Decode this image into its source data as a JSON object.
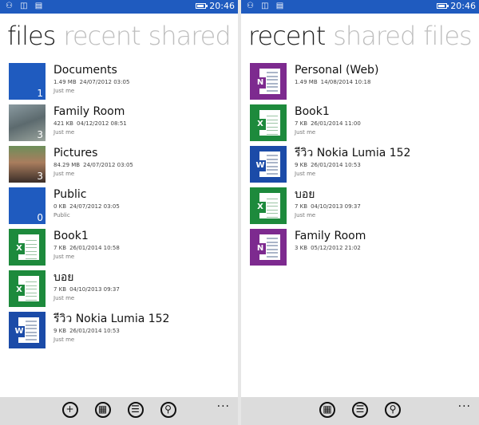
{
  "status": {
    "time": "20:46",
    "icons": "⚇ ◫ ▤"
  },
  "left": {
    "pivot": [
      "files",
      "recent",
      "shared"
    ],
    "items": [
      {
        "type": "folder",
        "name": "Documents",
        "size": "1.49 MB",
        "date": "24/07/2012 03:05",
        "owner": "Just me",
        "count": "1"
      },
      {
        "type": "photo1",
        "name": "Family Room",
        "size": "421 KB",
        "date": "04/12/2012 08:51",
        "owner": "Just me",
        "count": "3"
      },
      {
        "type": "photo2",
        "name": "Pictures",
        "size": "84.29 MB",
        "date": "24/07/2012 03:05",
        "owner": "Just me",
        "count": "3"
      },
      {
        "type": "folder",
        "name": "Public",
        "size": "0 KB",
        "date": "24/07/2012 03:05",
        "owner": "Public",
        "count": "0"
      },
      {
        "type": "excel",
        "name": "Book1",
        "size": "7 KB",
        "date": "26/01/2014 10:58",
        "owner": "Just me",
        "badge": "X"
      },
      {
        "type": "excel",
        "name": "บอย",
        "size": "7 KB",
        "date": "04/10/2013 09:37",
        "owner": "Just me",
        "badge": "X"
      },
      {
        "type": "word",
        "name": "รีวิว Nokia Lumia 152",
        "size": "9 KB",
        "date": "26/01/2014 10:53",
        "owner": "Just me",
        "badge": "W"
      }
    ],
    "appbar": {
      "icons": [
        "add-icon",
        "tiles-icon",
        "select-icon",
        "search-icon"
      ],
      "glyphs": [
        "+",
        "▦",
        "☰",
        "⚲"
      ],
      "more": "..."
    }
  },
  "right": {
    "pivot": [
      "recent",
      "shared",
      "files"
    ],
    "items": [
      {
        "type": "onenote",
        "name": "Personal (Web)",
        "size": "1.49 MB",
        "date": "14/08/2014 10:18",
        "owner": "",
        "badge": "N"
      },
      {
        "type": "excel",
        "name": "Book1",
        "size": "7 KB",
        "date": "26/01/2014 11:00",
        "owner": "Just me",
        "badge": "X"
      },
      {
        "type": "word",
        "name": "รีวิว Nokia Lumia 152",
        "size": "9 KB",
        "date": "26/01/2014 10:53",
        "owner": "Just me",
        "badge": "W"
      },
      {
        "type": "excel",
        "name": "บอย",
        "size": "7 KB",
        "date": "04/10/2013 09:37",
        "owner": "Just me",
        "badge": "X"
      },
      {
        "type": "onenote",
        "name": "Family Room",
        "size": "3 KB",
        "date": "05/12/2012 21:02",
        "owner": "",
        "badge": "N"
      }
    ],
    "appbar": {
      "icons": [
        "tiles-icon",
        "select-icon",
        "search-icon"
      ],
      "glyphs": [
        "▦",
        "☰",
        "⚲"
      ],
      "more": "..."
    }
  },
  "colors": {
    "accent": "#1f5bbf",
    "excel": "#1d8a3c",
    "word": "#1b4ba8",
    "onenote": "#7d2a8f"
  }
}
